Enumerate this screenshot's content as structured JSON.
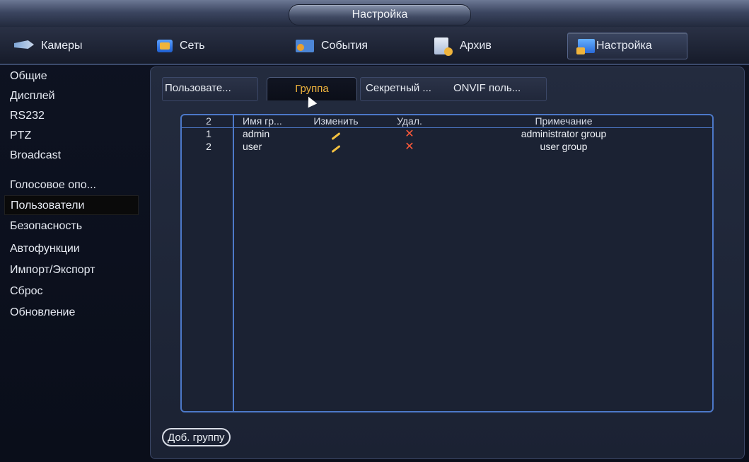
{
  "window": {
    "title": "Настройка"
  },
  "topnav": [
    {
      "label": "Камеры",
      "icon": "camera-icon"
    },
    {
      "label": "Сеть",
      "icon": "network-icon"
    },
    {
      "label": "События",
      "icon": "events-icon"
    },
    {
      "label": "Архив",
      "icon": "archive-icon"
    },
    {
      "label": "Настройка",
      "icon": "settings-icon",
      "active": true
    }
  ],
  "sidebar": {
    "items": [
      {
        "label": "Общие"
      },
      {
        "label": "Дисплей"
      },
      {
        "label": "RS232"
      },
      {
        "label": "PTZ"
      },
      {
        "label": "Broadcast"
      },
      {
        "label": "Голосовое опо..."
      },
      {
        "label": "Пользователи",
        "active": true
      },
      {
        "label": "Безопасность"
      },
      {
        "label": "Автофункции"
      },
      {
        "label": "Импорт/Экспорт"
      },
      {
        "label": "Сброс"
      },
      {
        "label": "Обновление"
      }
    ]
  },
  "subtabs": [
    {
      "label": "Пользовате..."
    },
    {
      "label": "Группа",
      "active": true
    },
    {
      "label": "Секретный ..."
    },
    {
      "label": "ONVIF поль..."
    }
  ],
  "table": {
    "headers": {
      "count": "2",
      "name": "Имя гр...",
      "edit": "Изменить",
      "delete": "Удал.",
      "note": "Примечание"
    },
    "rows": [
      {
        "num": "1",
        "name": "admin",
        "note": "administrator group"
      },
      {
        "num": "2",
        "name": "user",
        "note": "user group"
      }
    ]
  },
  "actions": {
    "add_group": "Доб. группу"
  },
  "colors": {
    "accent": "#f0b43c",
    "grid_border": "#4c78c8",
    "delete": "#ff5a3a"
  }
}
